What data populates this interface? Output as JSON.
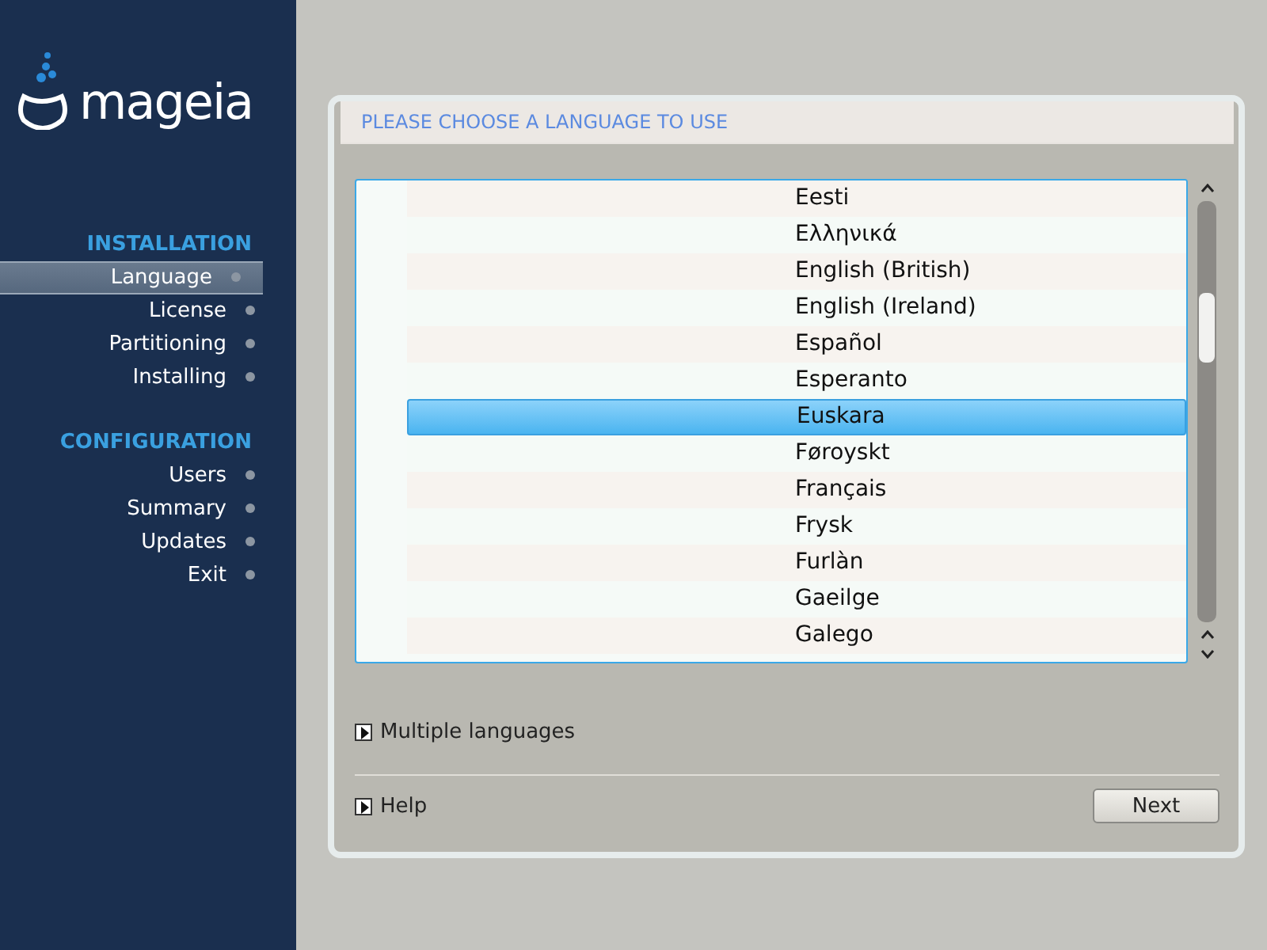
{
  "logo": {
    "text": "mageia"
  },
  "sidebar": {
    "sections": [
      {
        "title": "INSTALLATION",
        "items": [
          {
            "label": "Language",
            "selected": true
          },
          {
            "label": "License",
            "selected": false
          },
          {
            "label": "Partitioning",
            "selected": false
          },
          {
            "label": "Installing",
            "selected": false
          }
        ]
      },
      {
        "title": "CONFIGURATION",
        "items": [
          {
            "label": "Users",
            "selected": false
          },
          {
            "label": "Summary",
            "selected": false
          },
          {
            "label": "Updates",
            "selected": false
          },
          {
            "label": "Exit",
            "selected": false
          }
        ]
      }
    ]
  },
  "panel": {
    "title": "PLEASE CHOOSE A LANGUAGE TO USE",
    "languages": [
      {
        "label": "Eesti",
        "selected": false
      },
      {
        "label": "Ελληνικά",
        "selected": false
      },
      {
        "label": "English (British)",
        "selected": false
      },
      {
        "label": "English (Ireland)",
        "selected": false
      },
      {
        "label": "Español",
        "selected": false
      },
      {
        "label": "Esperanto",
        "selected": false
      },
      {
        "label": "Euskara",
        "selected": true
      },
      {
        "label": "Føroyskt",
        "selected": false
      },
      {
        "label": "Français",
        "selected": false
      },
      {
        "label": "Frysk",
        "selected": false
      },
      {
        "label": "Furlàn",
        "selected": false
      },
      {
        "label": "Gaeilge",
        "selected": false
      },
      {
        "label": "Galego",
        "selected": false
      }
    ],
    "expanders": [
      {
        "label": "Multiple languages",
        "expanded": false
      }
    ],
    "help": {
      "label": "Help",
      "expanded": false
    },
    "buttons": [
      "Next"
    ]
  }
}
